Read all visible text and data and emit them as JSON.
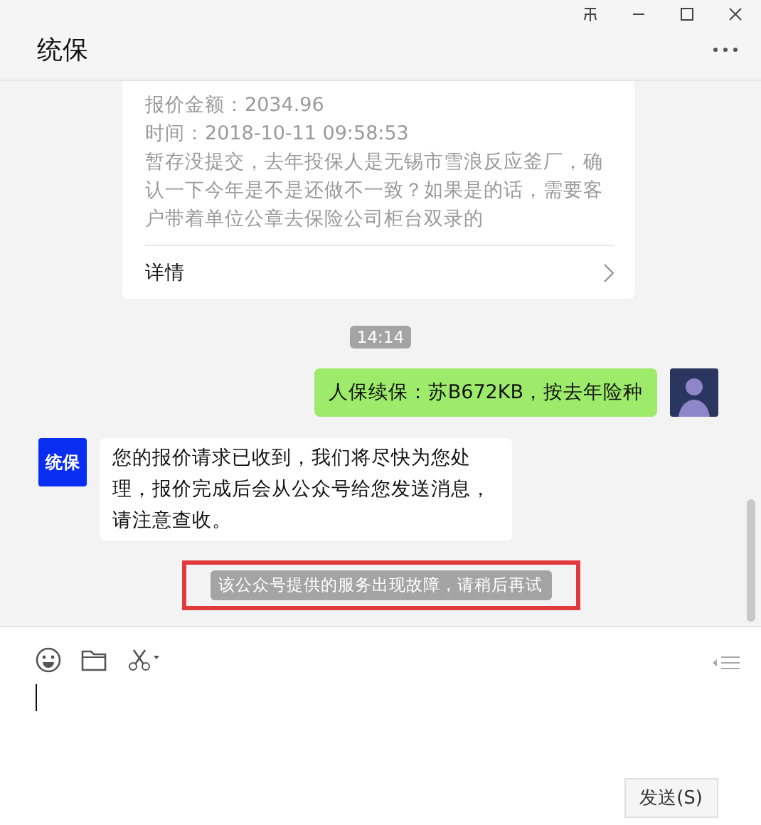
{
  "window": {
    "title": "统保"
  },
  "messages": [
    {
      "kind": "card",
      "lines": [
        "报价金额：2034.96",
        "时间：2018-10-11 09:58:53",
        "暂存没提交，去年投保人是无锡市雪浪反应釜厂，确认一下今年是不是还做不一致？如果是的话，需要客户带着单位公章去保险公司柜台双录的"
      ],
      "link": "详情"
    },
    {
      "kind": "time",
      "text": "14:14"
    },
    {
      "kind": "sent",
      "text": "人保续保：苏B672KB，按去年险种"
    },
    {
      "kind": "received",
      "logo_text": "统保",
      "text": "您的报价请求已收到，我们将尽快为您处理，报价完成后会从公众号给您发送消息，请注意查收。"
    },
    {
      "kind": "notice",
      "text": "该公众号提供的服务出现故障，请稍后再试",
      "highlighted": true
    }
  ],
  "composer": {
    "send_button": "发送(S)"
  }
}
